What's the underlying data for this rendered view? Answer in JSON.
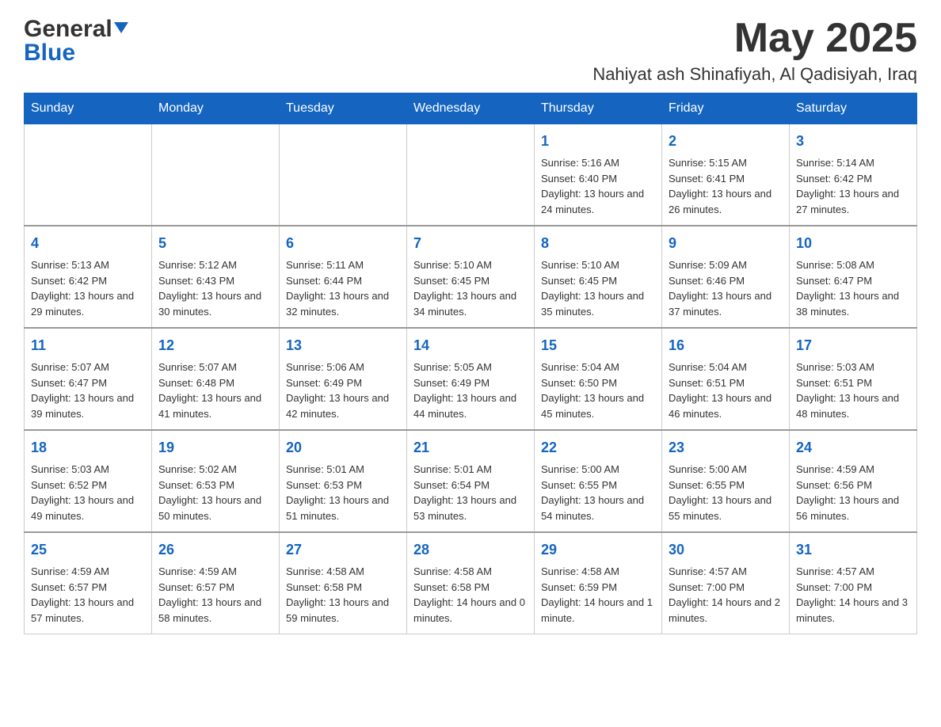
{
  "header": {
    "logo_text_black": "General",
    "logo_text_blue": "Blue",
    "month_title": "May 2025",
    "location": "Nahiyat ash Shinafiyah, Al Qadisiyah, Iraq"
  },
  "days_of_week": [
    "Sunday",
    "Monday",
    "Tuesday",
    "Wednesday",
    "Thursday",
    "Friday",
    "Saturday"
  ],
  "weeks": [
    [
      {
        "day": "",
        "info": ""
      },
      {
        "day": "",
        "info": ""
      },
      {
        "day": "",
        "info": ""
      },
      {
        "day": "",
        "info": ""
      },
      {
        "day": "1",
        "info": "Sunrise: 5:16 AM\nSunset: 6:40 PM\nDaylight: 13 hours and 24 minutes."
      },
      {
        "day": "2",
        "info": "Sunrise: 5:15 AM\nSunset: 6:41 PM\nDaylight: 13 hours and 26 minutes."
      },
      {
        "day": "3",
        "info": "Sunrise: 5:14 AM\nSunset: 6:42 PM\nDaylight: 13 hours and 27 minutes."
      }
    ],
    [
      {
        "day": "4",
        "info": "Sunrise: 5:13 AM\nSunset: 6:42 PM\nDaylight: 13 hours and 29 minutes."
      },
      {
        "day": "5",
        "info": "Sunrise: 5:12 AM\nSunset: 6:43 PM\nDaylight: 13 hours and 30 minutes."
      },
      {
        "day": "6",
        "info": "Sunrise: 5:11 AM\nSunset: 6:44 PM\nDaylight: 13 hours and 32 minutes."
      },
      {
        "day": "7",
        "info": "Sunrise: 5:10 AM\nSunset: 6:45 PM\nDaylight: 13 hours and 34 minutes."
      },
      {
        "day": "8",
        "info": "Sunrise: 5:10 AM\nSunset: 6:45 PM\nDaylight: 13 hours and 35 minutes."
      },
      {
        "day": "9",
        "info": "Sunrise: 5:09 AM\nSunset: 6:46 PM\nDaylight: 13 hours and 37 minutes."
      },
      {
        "day": "10",
        "info": "Sunrise: 5:08 AM\nSunset: 6:47 PM\nDaylight: 13 hours and 38 minutes."
      }
    ],
    [
      {
        "day": "11",
        "info": "Sunrise: 5:07 AM\nSunset: 6:47 PM\nDaylight: 13 hours and 39 minutes."
      },
      {
        "day": "12",
        "info": "Sunrise: 5:07 AM\nSunset: 6:48 PM\nDaylight: 13 hours and 41 minutes."
      },
      {
        "day": "13",
        "info": "Sunrise: 5:06 AM\nSunset: 6:49 PM\nDaylight: 13 hours and 42 minutes."
      },
      {
        "day": "14",
        "info": "Sunrise: 5:05 AM\nSunset: 6:49 PM\nDaylight: 13 hours and 44 minutes."
      },
      {
        "day": "15",
        "info": "Sunrise: 5:04 AM\nSunset: 6:50 PM\nDaylight: 13 hours and 45 minutes."
      },
      {
        "day": "16",
        "info": "Sunrise: 5:04 AM\nSunset: 6:51 PM\nDaylight: 13 hours and 46 minutes."
      },
      {
        "day": "17",
        "info": "Sunrise: 5:03 AM\nSunset: 6:51 PM\nDaylight: 13 hours and 48 minutes."
      }
    ],
    [
      {
        "day": "18",
        "info": "Sunrise: 5:03 AM\nSunset: 6:52 PM\nDaylight: 13 hours and 49 minutes."
      },
      {
        "day": "19",
        "info": "Sunrise: 5:02 AM\nSunset: 6:53 PM\nDaylight: 13 hours and 50 minutes."
      },
      {
        "day": "20",
        "info": "Sunrise: 5:01 AM\nSunset: 6:53 PM\nDaylight: 13 hours and 51 minutes."
      },
      {
        "day": "21",
        "info": "Sunrise: 5:01 AM\nSunset: 6:54 PM\nDaylight: 13 hours and 53 minutes."
      },
      {
        "day": "22",
        "info": "Sunrise: 5:00 AM\nSunset: 6:55 PM\nDaylight: 13 hours and 54 minutes."
      },
      {
        "day": "23",
        "info": "Sunrise: 5:00 AM\nSunset: 6:55 PM\nDaylight: 13 hours and 55 minutes."
      },
      {
        "day": "24",
        "info": "Sunrise: 4:59 AM\nSunset: 6:56 PM\nDaylight: 13 hours and 56 minutes."
      }
    ],
    [
      {
        "day": "25",
        "info": "Sunrise: 4:59 AM\nSunset: 6:57 PM\nDaylight: 13 hours and 57 minutes."
      },
      {
        "day": "26",
        "info": "Sunrise: 4:59 AM\nSunset: 6:57 PM\nDaylight: 13 hours and 58 minutes."
      },
      {
        "day": "27",
        "info": "Sunrise: 4:58 AM\nSunset: 6:58 PM\nDaylight: 13 hours and 59 minutes."
      },
      {
        "day": "28",
        "info": "Sunrise: 4:58 AM\nSunset: 6:58 PM\nDaylight: 14 hours and 0 minutes."
      },
      {
        "day": "29",
        "info": "Sunrise: 4:58 AM\nSunset: 6:59 PM\nDaylight: 14 hours and 1 minute."
      },
      {
        "day": "30",
        "info": "Sunrise: 4:57 AM\nSunset: 7:00 PM\nDaylight: 14 hours and 2 minutes."
      },
      {
        "day": "31",
        "info": "Sunrise: 4:57 AM\nSunset: 7:00 PM\nDaylight: 14 hours and 3 minutes."
      }
    ]
  ]
}
